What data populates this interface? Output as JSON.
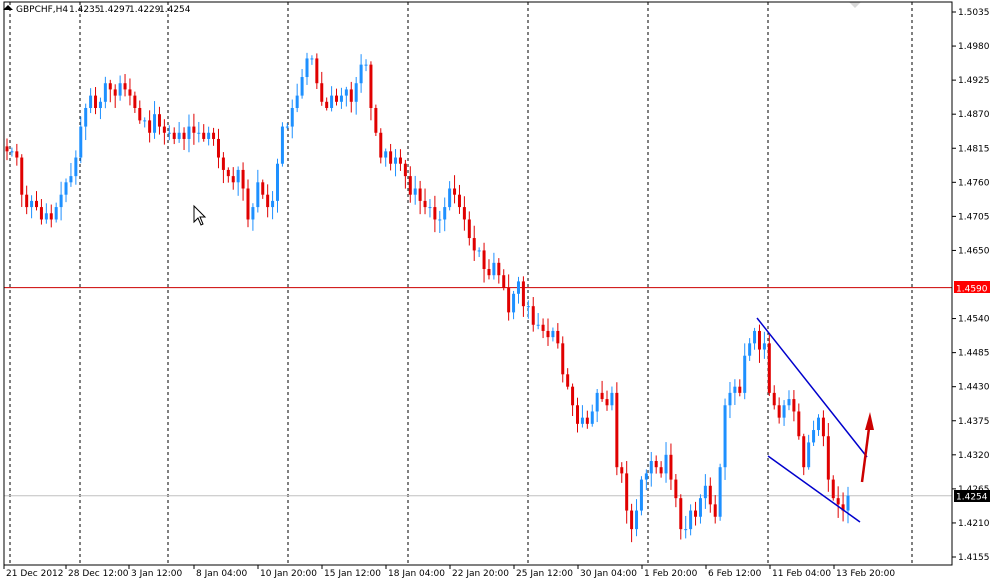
{
  "header": {
    "symbol": "GBPCHF,H4",
    "open": "1.4235",
    "high": "1.4297",
    "low": "1.4229",
    "close": "1.4254"
  },
  "colors": {
    "background": "#ffffff",
    "bull": "#1e90ff",
    "bear": "#e00000",
    "grid": "#000000",
    "hline": "#cc0000",
    "channel": "#0000cc",
    "arrow": "#cc0000",
    "price_tag_red": "#ff0000",
    "price_tag_black": "#000000"
  },
  "chart_data": {
    "type": "candlestick",
    "title": "GBPCHF,H4",
    "xlabel": "",
    "ylabel": "",
    "ylim": [
      1.415,
      1.506
    ],
    "grid": "vertical dashed",
    "y_ticks": [
      "1.5035",
      "1.4980",
      "1.4925",
      "1.4870",
      "1.4815",
      "1.4760",
      "1.4705",
      "1.4650",
      "1.4540",
      "1.4485",
      "1.4430",
      "1.4375",
      "1.4320",
      "1.4265",
      "1.4210",
      "1.4155"
    ],
    "x_ticks": [
      "21 Dec 2012",
      "28 Dec 12:00",
      "3 Jan 12:00",
      "8 Jan 04:00",
      "10 Jan 20:00",
      "15 Jan 12:00",
      "18 Jan 04:00",
      "22 Jan 20:00",
      "25 Jan 12:00",
      "30 Jan 04:00",
      "1 Feb 20:00",
      "6 Feb 12:00",
      "11 Feb 04:00",
      "13 Feb 20:00"
    ],
    "horizontal_line": {
      "price": 1.459,
      "label": "1.4590"
    },
    "current_price": {
      "price": 1.4254,
      "label": "1.4254"
    },
    "close_series": [
      1.481,
      1.481,
      1.48,
      1.474,
      1.472,
      1.473,
      1.472,
      1.47,
      1.471,
      1.47,
      1.472,
      1.474,
      1.476,
      1.477,
      1.48,
      1.485,
      1.488,
      1.49,
      1.488,
      1.489,
      1.492,
      1.491,
      1.49,
      1.492,
      1.491,
      1.49,
      1.488,
      1.486,
      1.486,
      1.484,
      1.487,
      1.485,
      1.484,
      1.484,
      1.483,
      1.484,
      1.483,
      1.485,
      1.484,
      1.484,
      1.483,
      1.484,
      1.483,
      1.48,
      1.478,
      1.477,
      1.476,
      1.478,
      1.475,
      1.47,
      1.472,
      1.476,
      1.474,
      1.472,
      1.473,
      1.479,
      1.485,
      1.485,
      1.488,
      1.49,
      1.493,
      1.496,
      1.496,
      1.492,
      1.489,
      1.488,
      1.49,
      1.489,
      1.49,
      1.491,
      1.489,
      1.492,
      1.495,
      1.495,
      1.488,
      1.484,
      1.48,
      1.481,
      1.479,
      1.48,
      1.479,
      1.477,
      1.474,
      1.475,
      1.473,
      1.472,
      1.472,
      1.47,
      1.47,
      1.472,
      1.475,
      1.474,
      1.472,
      1.47,
      1.467,
      1.465,
      1.465,
      1.462,
      1.461,
      1.463,
      1.461,
      1.459,
      1.455,
      1.458,
      1.46,
      1.456,
      1.456,
      1.453,
      1.453,
      1.452,
      1.451,
      1.452,
      1.45,
      1.445,
      1.443,
      1.44,
      1.437,
      1.438,
      1.437,
      1.439,
      1.442,
      1.441,
      1.44,
      1.442,
      1.43,
      1.429,
      1.423,
      1.42,
      1.423,
      1.428,
      1.429,
      1.431,
      1.43,
      1.429,
      1.432,
      1.428,
      1.425,
      1.42,
      1.42,
      1.423,
      1.422,
      1.425,
      1.427,
      1.424,
      1.422,
      1.43,
      1.44,
      1.442,
      1.443,
      1.442,
      1.448,
      1.45,
      1.452,
      1.449,
      1.45,
      1.442,
      1.44,
      1.438,
      1.44,
      1.441,
      1.439,
      1.435,
      1.43,
      1.434,
      1.436,
      1.438,
      1.435,
      1.428,
      1.425,
      1.424,
      1.423,
      1.4254
    ]
  }
}
